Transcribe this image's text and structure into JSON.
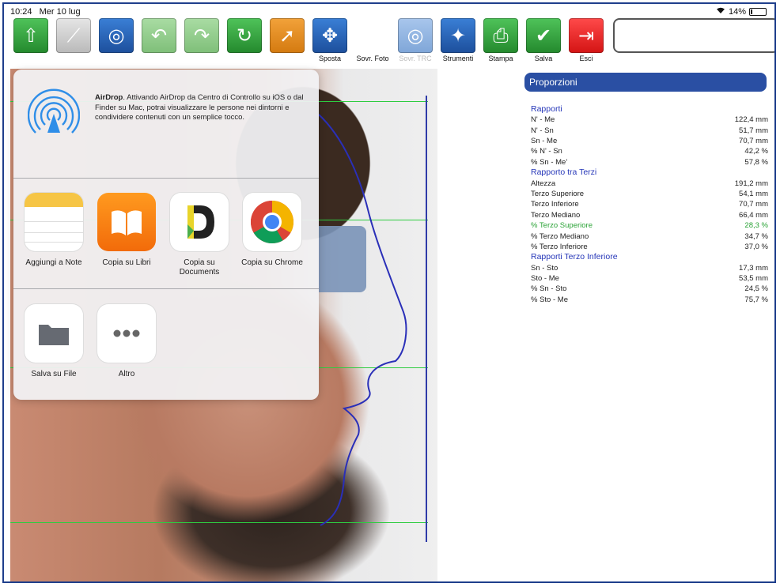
{
  "status": {
    "time": "10:24",
    "date": "Mer 10 lug",
    "wifi": "wifi-icon",
    "battery": "14%"
  },
  "toolbar": [
    {
      "id": "import",
      "label": "",
      "color": "green",
      "icon": "import-icon",
      "dim": false
    },
    {
      "id": "calibra",
      "label": "",
      "color": "gray",
      "icon": "ruler-icon",
      "dim": false
    },
    {
      "id": "ind",
      "label": "",
      "color": "blue",
      "icon": "point-icon",
      "dim": false
    },
    {
      "id": "undo",
      "label": "",
      "color": "lgreen",
      "icon": "undo-icon",
      "dim": true
    },
    {
      "id": "redo",
      "label": "",
      "color": "lgreen",
      "icon": "redo-icon",
      "dim": true
    },
    {
      "id": "rip",
      "label": "",
      "color": "green",
      "icon": "replay-icon",
      "dim": false
    },
    {
      "id": "sel",
      "label": "",
      "color": "orange",
      "icon": "cursor-icon",
      "dim": false
    },
    {
      "id": "sposta",
      "label": "Sposta",
      "color": "blue",
      "icon": "move-icon",
      "dim": false
    },
    {
      "id": "sovrfoto",
      "label": "Sovr. Foto",
      "color": "photo",
      "icon": "person-icon",
      "dim": false
    },
    {
      "id": "sovrtrc",
      "label": "Sovr. TRC",
      "color": "lblue",
      "icon": "overlay-icon",
      "dim": true
    },
    {
      "id": "strumenti",
      "label": "Strumenti",
      "color": "blue",
      "icon": "wand-icon",
      "dim": false
    },
    {
      "id": "stampa",
      "label": "Stampa",
      "color": "green",
      "icon": "printer-icon",
      "dim": false
    },
    {
      "id": "salva",
      "label": "Salva",
      "color": "green",
      "icon": "check-icon",
      "dim": false
    },
    {
      "id": "esci",
      "label": "Esci",
      "color": "red",
      "icon": "exit-icon",
      "dim": false
    }
  ],
  "share": {
    "airdrop_title": "AirDrop",
    "airdrop_text": ". Attivando AirDrop da Centro di Controllo su iOS o dal Finder su Mac, potrai visualizzare le persone nei dintorni e condividere contenuti con un semplice tocco.",
    "apps": [
      {
        "label": "Aggiungi a Note",
        "icon": "notes-icon"
      },
      {
        "label": "Copia su Libri",
        "icon": "books-icon"
      },
      {
        "label": "Copia su Documents",
        "icon": "documents-icon"
      },
      {
        "label": "Copia su Chrome",
        "icon": "chrome-icon"
      }
    ],
    "actions": [
      {
        "label": "Salva su File",
        "icon": "folder-icon"
      },
      {
        "label": "Altro",
        "icon": "more-icon"
      }
    ]
  },
  "panel": {
    "title": "Proporzioni",
    "sections": [
      {
        "title": "Rapporti",
        "rows": [
          {
            "label": "N' - Me",
            "value": "122,4 mm"
          },
          {
            "label": "N' - Sn",
            "value": "51,7 mm"
          },
          {
            "label": "Sn - Me",
            "value": "70,7 mm"
          },
          {
            "label": "% N' - Sn",
            "value": "42,2 %"
          },
          {
            "label": "% Sn - Me'",
            "value": "57,8 %"
          }
        ]
      },
      {
        "title": "Rapporto tra Terzi",
        "rows": [
          {
            "label": "Altezza",
            "value": "191,2 mm"
          },
          {
            "label": "Terzo Superiore",
            "value": "54,1 mm"
          },
          {
            "label": "Terzo Inferiore",
            "value": "70,7 mm"
          },
          {
            "label": "Terzo Mediano",
            "value": "66,4 mm"
          },
          {
            "label": "% Terzo Superiore",
            "value": "28,3 %",
            "highlight": true
          },
          {
            "label": "% Terzo Mediano",
            "value": "34,7 %"
          },
          {
            "label": "% Terzo Inferiore",
            "value": "37,0 %"
          }
        ]
      },
      {
        "title": "Rapporti Terzo Inferiore",
        "rows": [
          {
            "label": "Sn - Sto",
            "value": "17,3 mm"
          },
          {
            "label": "Sto - Me",
            "value": "53,5 mm"
          },
          {
            "label": "% Sn - Sto",
            "value": "24,5 %"
          },
          {
            "label": "% Sto - Me",
            "value": "75,7 %"
          }
        ]
      }
    ]
  }
}
